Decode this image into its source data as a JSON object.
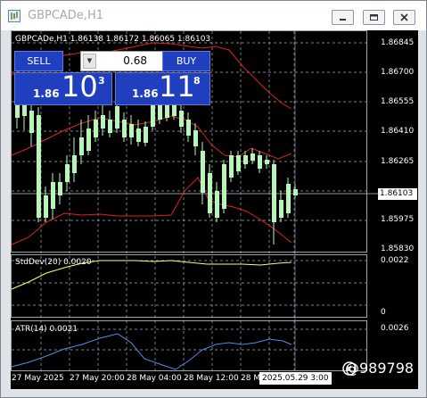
{
  "window": {
    "title": "GBPCADe,H1"
  },
  "chart": {
    "header": "GBPCADe,H1  1.86138 1.86172 1.86065 1.86103",
    "current_price": "1.86103",
    "time_marker": "2025.05.29 3:00",
    "price_ticks": [
      "1.86845",
      "1.86700",
      "1.86555",
      "1.86410",
      "1.86265",
      "1.86120",
      "1.85975",
      "1.85830"
    ],
    "time_ticks": [
      "27 May 2025",
      "27 May 20:00",
      "28 May 04:00",
      "28 May 12:00",
      "28 M"
    ],
    "colors": {
      "background": "#000000",
      "bull_candle": "#b8f5b8",
      "bollinger": "#e02020",
      "stddev": "#ffff66",
      "atr": "#4f8fe8",
      "grid": "#cfd8e0"
    }
  },
  "trade_panel": {
    "sell_label": "SELL",
    "buy_label": "BUY",
    "lot": "0.68",
    "sell_prefix": "1.86",
    "sell_big": "10",
    "sell_sup": "3",
    "buy_prefix": "1.86",
    "buy_big": "11",
    "buy_sup": "8"
  },
  "stddev_panel": {
    "label": "StdDev(20) 0.0020",
    "ticks": [
      "0.0022",
      "0"
    ]
  },
  "atr_panel": {
    "label": "ATR(14) 0.0021",
    "ticks": [
      "0.0026"
    ]
  },
  "watermark": {
    "text": "@989798"
  }
}
